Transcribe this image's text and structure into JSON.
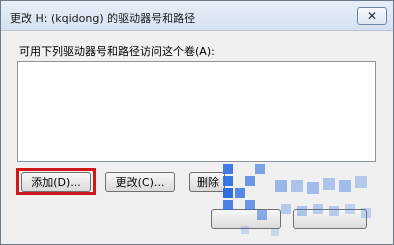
{
  "dialog": {
    "title": "更改 H: (kqidong) 的驱动器号和路径",
    "close_label": "✕",
    "instruction": "可用下列驱动器号和路径访问这个卷(A):"
  },
  "buttons": {
    "add": "添加(D)...",
    "change": "更改(C)...",
    "remove": "删除"
  },
  "colors": {
    "highlight": "#d0191a",
    "watermark_blue": "#2f6fe0"
  }
}
